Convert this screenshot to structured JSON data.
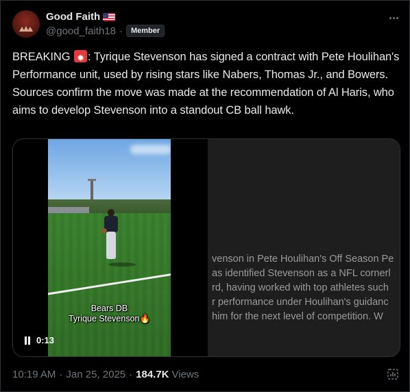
{
  "author": {
    "display_name": "Good Faith",
    "flag": "US-flag",
    "handle": "@good_faith18",
    "badge": "Member"
  },
  "tweet": {
    "text_before_emoji": "BREAKING ",
    "emoji": "police-siren-emoji",
    "text_after_emoji": ": Tyrique Stevenson has signed a contract with Pete Houlihan's Performance unit, used by rising stars like Nabers, Thomas Jr., and Bowers. Sources confirm the move was made at the recommendation of Al Haris, who aims to develop Stevenson into a standout CB ball hawk."
  },
  "media": {
    "caption_line1": "Bears DB",
    "caption_line2": "Tyrique Stevenson",
    "elapsed": "0:13",
    "article_lines": [
      "venson in Pete Houlihan's Off Season Pe",
      "as identified Stevenson as a NFL cornerl",
      "rd, having worked with top athletes such",
      "r performance under Houlihan's guidanc",
      " him for the next level of competition. W"
    ]
  },
  "footer": {
    "time": "10:19 AM",
    "date": "Jan 25, 2025",
    "views_count": "184.7K",
    "views_label": "Views"
  },
  "colors": {
    "background": "#000000",
    "text": "#e7e9ea",
    "muted": "#71767b",
    "border": "#2f3336"
  }
}
